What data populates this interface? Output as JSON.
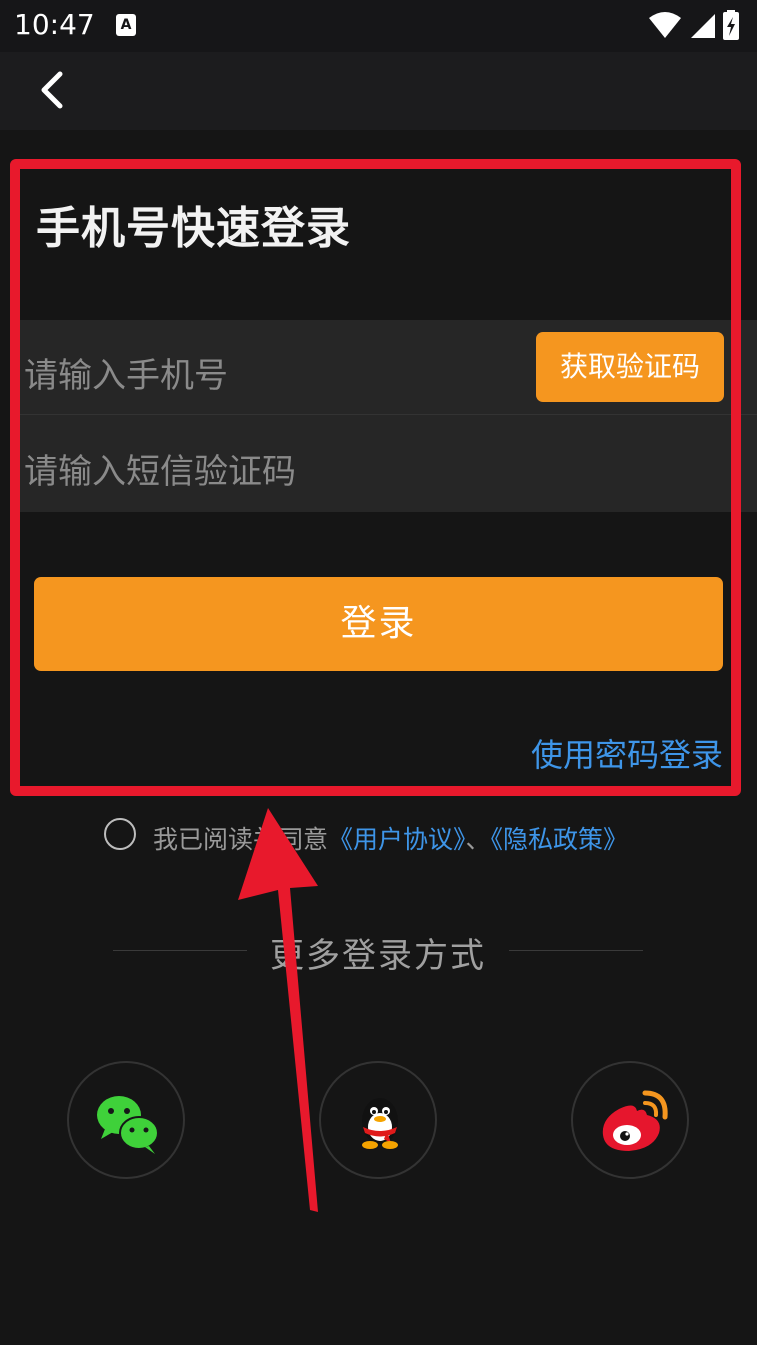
{
  "status_bar": {
    "time": "10:47",
    "notification_badge": "A"
  },
  "login": {
    "title": "手机号快速登录",
    "phone_placeholder": "请输入手机号",
    "get_code_label": "获取验证码",
    "code_placeholder": "请输入短信验证码",
    "login_button_label": "登录",
    "password_login_link": "使用密码登录"
  },
  "agreement": {
    "prefix": "我已阅读并同意",
    "user_agreement": "《用户协议》",
    "separator": "、",
    "privacy_policy": "《隐私政策》"
  },
  "more_login": {
    "label": "更多登录方式"
  },
  "social": [
    {
      "icon": "wechat-icon"
    },
    {
      "icon": "qq-icon"
    },
    {
      "icon": "weibo-icon"
    }
  ],
  "colors": {
    "accent": "#f5961f",
    "link": "#3e95e8",
    "highlight": "#e8192c",
    "background": "#151515"
  }
}
